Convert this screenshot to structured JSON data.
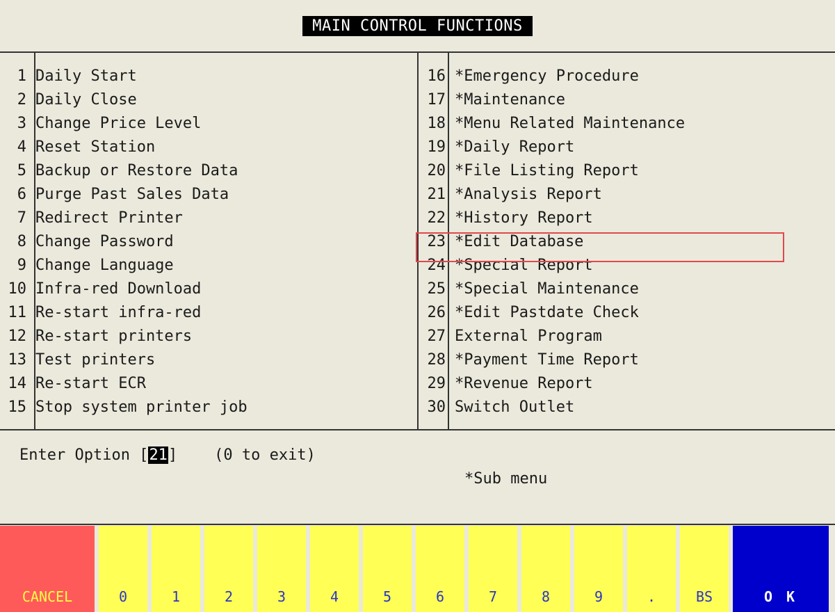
{
  "title": "MAIN CONTROL FUNCTIONS",
  "menu": {
    "left": [
      {
        "num": "1",
        "label": "Daily Start"
      },
      {
        "num": "2",
        "label": "Daily Close"
      },
      {
        "num": "3",
        "label": "Change Price Level"
      },
      {
        "num": "4",
        "label": "Reset Station"
      },
      {
        "num": "5",
        "label": "Backup or Restore Data"
      },
      {
        "num": "6",
        "label": "Purge Past Sales Data"
      },
      {
        "num": "7",
        "label": "Redirect Printer"
      },
      {
        "num": "8",
        "label": "Change Password"
      },
      {
        "num": "9",
        "label": "Change Language"
      },
      {
        "num": "10",
        "label": "Infra-red Download"
      },
      {
        "num": "11",
        "label": "Re-start infra-red"
      },
      {
        "num": "12",
        "label": "Re-start printers"
      },
      {
        "num": "13",
        "label": "Test printers"
      },
      {
        "num": "14",
        "label": "Re-start ECR"
      },
      {
        "num": "15",
        "label": "Stop system printer job"
      }
    ],
    "right": [
      {
        "num": "16",
        "label": "*Emergency Procedure"
      },
      {
        "num": "17",
        "label": "*Maintenance"
      },
      {
        "num": "18",
        "label": "*Menu Related Maintenance"
      },
      {
        "num": "19",
        "label": "*Daily Report"
      },
      {
        "num": "20",
        "label": "*File Listing Report"
      },
      {
        "num": "21",
        "label": "*Analysis Report"
      },
      {
        "num": "22",
        "label": "*History Report"
      },
      {
        "num": "23",
        "label": "*Edit Database"
      },
      {
        "num": "24",
        "label": "*Special Report"
      },
      {
        "num": "25",
        "label": "*Special Maintenance"
      },
      {
        "num": "26",
        "label": "*Edit Pastdate Check"
      },
      {
        "num": "27",
        "label": "External Program"
      },
      {
        "num": "28",
        "label": "*Payment Time Report"
      },
      {
        "num": "29",
        "label": "*Revenue Report"
      },
      {
        "num": "30",
        "label": "Switch Outlet"
      }
    ]
  },
  "prompt": {
    "label": "Enter Option [",
    "value": "21",
    "close": "]",
    "hint": "    (0 to exit)",
    "sub_note": "*Sub menu"
  },
  "keypad": {
    "cancel": "CANCEL",
    "digits": [
      "0",
      "1",
      "2",
      "3",
      "4",
      "5",
      "6",
      "7",
      "8",
      "9"
    ],
    "dot": ".",
    "backspace": "BS",
    "ok": "O K"
  },
  "colors": {
    "background": "#ebe9dc",
    "highlight": "#e0484b",
    "cancel_key": "#ff5a5a",
    "digit_key": "#ffff55",
    "ok_key": "#0000cc"
  }
}
